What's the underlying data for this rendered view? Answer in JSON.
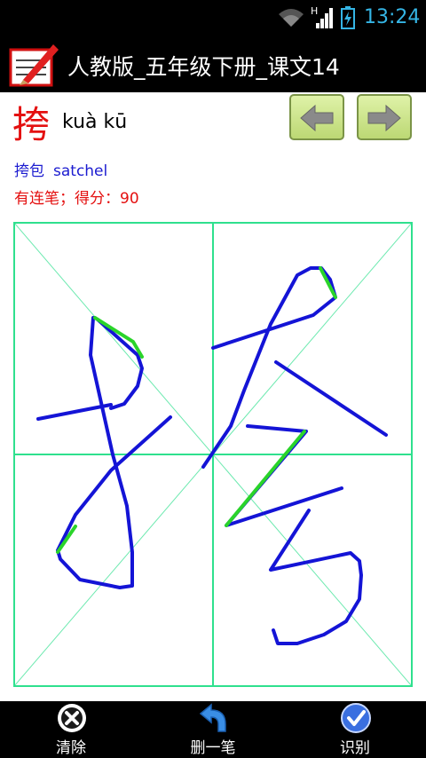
{
  "status_bar": {
    "time": "13:24",
    "network_letter": "H"
  },
  "title_bar": {
    "title": "人教版_五年级下册_课文14"
  },
  "lesson": {
    "character": "挎",
    "pinyin": "kuà kū",
    "word": "挎包",
    "word_english": "satchel",
    "result": "有连笔；得分：90"
  },
  "toolbar": {
    "clear_label": "清除",
    "undo_label": "删一笔",
    "recognize_label": "识别"
  },
  "colors": {
    "grid_line": "#2fe08e",
    "stroke": "#1414d6",
    "connected_stroke": "#2ad42a",
    "character": "#e41010",
    "word": "#1c1cd0"
  },
  "icons": [
    "wifi-icon",
    "signal-icon",
    "battery-icon",
    "app-icon",
    "arrow-left-icon",
    "arrow-right-icon",
    "close-icon",
    "undo-icon",
    "check-icon"
  ]
}
